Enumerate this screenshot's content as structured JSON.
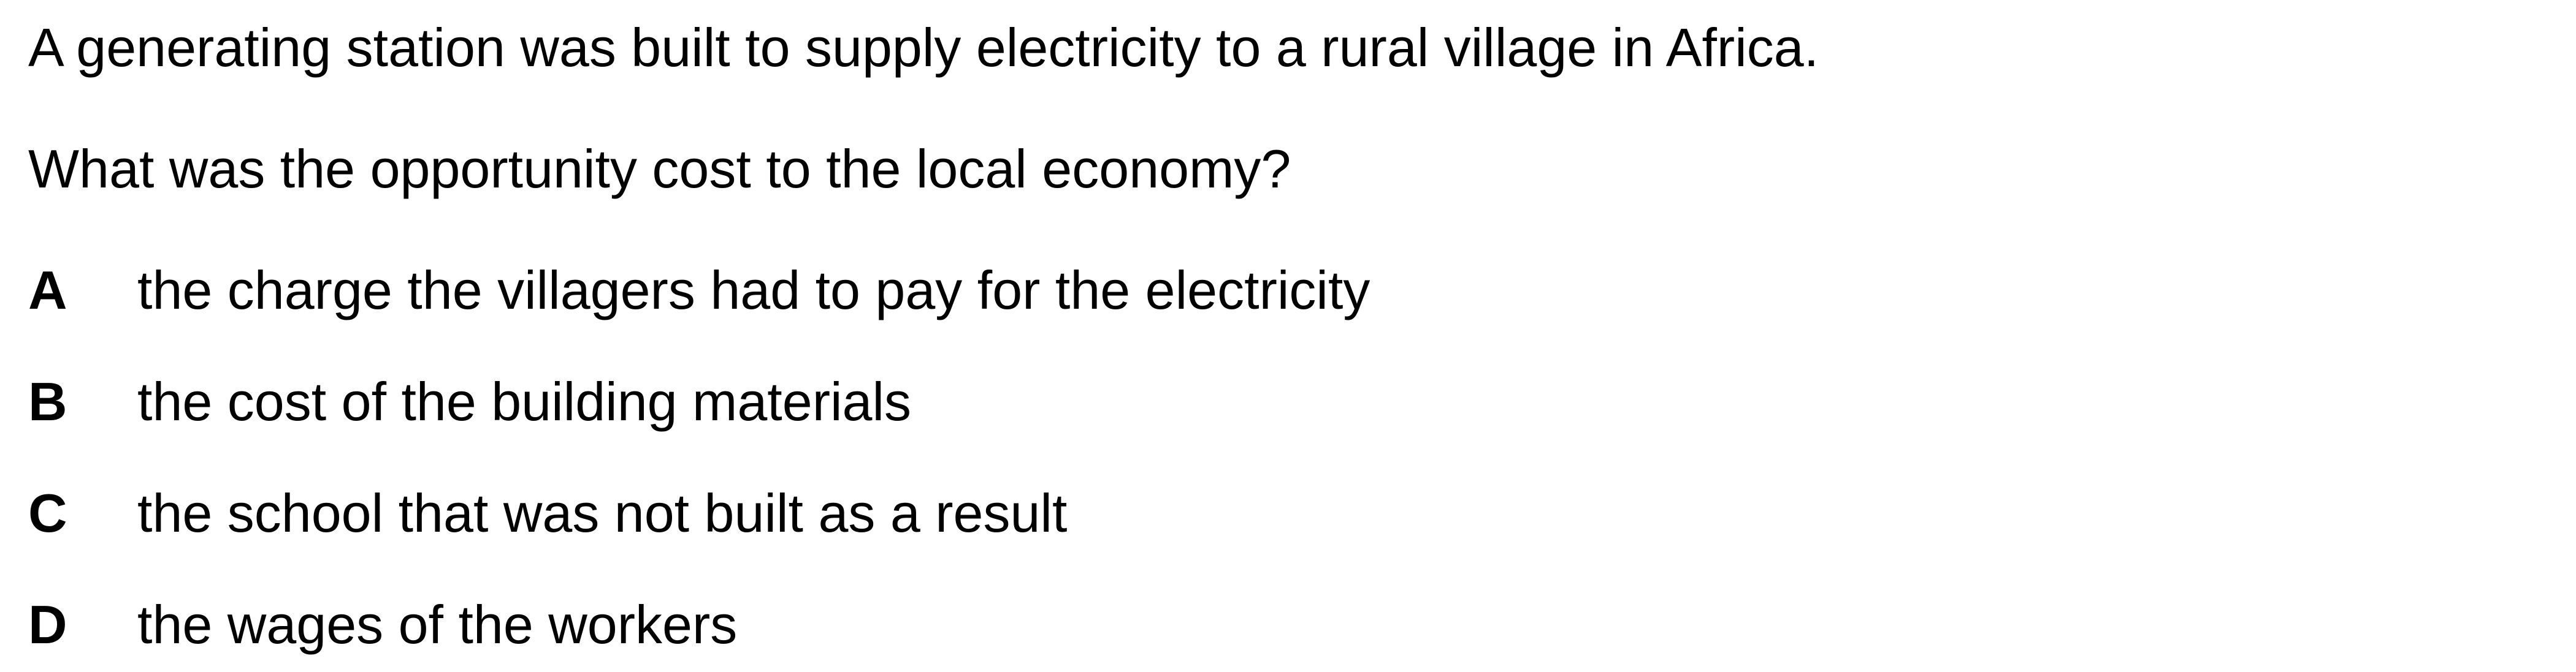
{
  "question": {
    "stem_lines": [
      "A generating station was built to supply electricity to a rural village in Africa.",
      "What was the opportunity cost to the local economy?"
    ],
    "options": [
      {
        "letter": "A",
        "text": "the charge the villagers had to pay for the electricity"
      },
      {
        "letter": "B",
        "text": "the cost of the building materials"
      },
      {
        "letter": "C",
        "text": "the school that was not built as a result"
      },
      {
        "letter": "D",
        "text": "the wages of the workers"
      }
    ]
  }
}
